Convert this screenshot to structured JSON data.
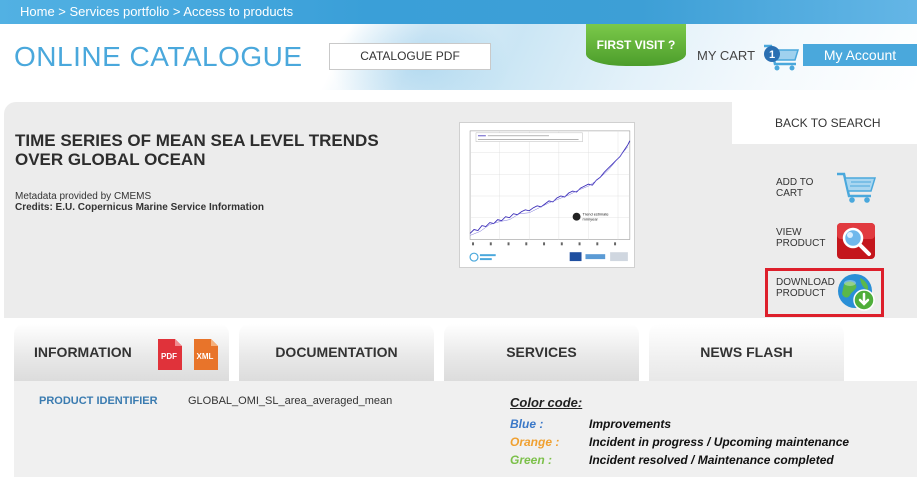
{
  "breadcrumb": {
    "home": "Home",
    "sep": " > ",
    "portfolio": "Services portfolio",
    "current": "Access to products"
  },
  "header": {
    "title": "ONLINE CATALOGUE",
    "catalogue_pdf": "CATALOGUE PDF",
    "first_visit": "FIRST VISIT ?",
    "my_cart": "MY CART",
    "cart_count": "1",
    "my_account": "My Account"
  },
  "product": {
    "title": "TIME SERIES OF MEAN SEA LEVEL TRENDS OVER GLOBAL OCEAN",
    "metadata_by": "Metadata provided by CMEMS",
    "credits": "Credits: E.U. Copernicus Marine Service Information",
    "thumbnail_icon": "sea-level-chart-thumbnail"
  },
  "actions": {
    "back_to_search": "BACK TO SEARCH",
    "add_to_cart": [
      "ADD TO",
      "CART"
    ],
    "view_product": [
      "VIEW",
      "PRODUCT"
    ],
    "download_product": [
      "DOWNLOAD",
      "PRODUCT"
    ]
  },
  "tabs": {
    "information": "INFORMATION",
    "documentation": "DOCUMENTATION",
    "services": "SERVICES",
    "news_flash": "NEWS FLASH",
    "pdf_badge": "PDF",
    "xml_badge": "XML"
  },
  "details": {
    "product_identifier_label": "PRODUCT IDENTIFIER",
    "product_identifier_value": "GLOBAL_OMI_SL_area_averaged_mean"
  },
  "color_code": {
    "title": "Color code:",
    "rows": [
      {
        "key": "Blue :",
        "value": "Improvements",
        "color": "#3a78c8"
      },
      {
        "key": "Orange :",
        "value": "Incident in progress / Upcoming maintenance",
        "color": "#f0a030"
      },
      {
        "key": "Green :",
        "value": "Incident resolved / Maintenance completed",
        "color": "#7cc04a"
      }
    ]
  },
  "colors": {
    "accent": "#4aa8dc",
    "highlight": "#dd1f2b",
    "green_button": "#5fb133"
  }
}
